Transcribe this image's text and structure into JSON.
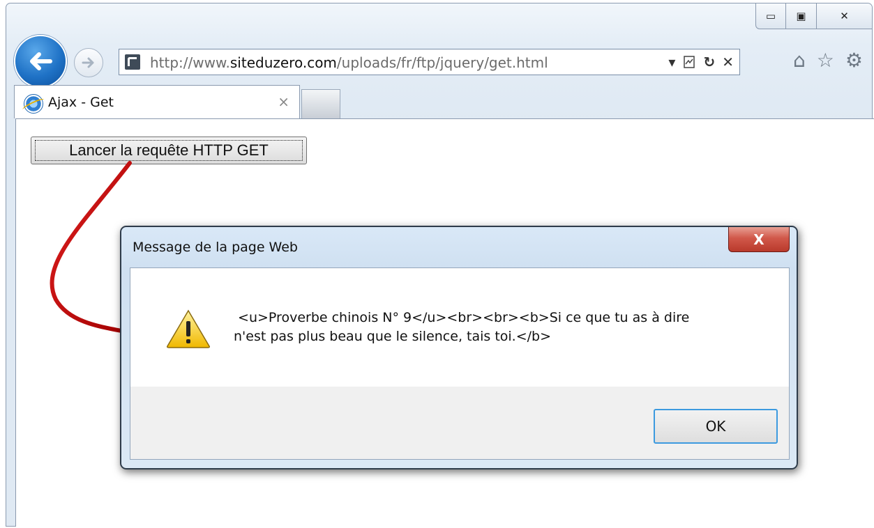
{
  "browser": {
    "url_prefix": "http://www.",
    "url_domain": "siteduzero.com",
    "url_path": "/uploads/fr/ftp/jquery/get.html",
    "tab": {
      "label": "Ajax - Get",
      "close_glyph": "×"
    },
    "icons": {
      "back": "back-arrow-icon",
      "forward": "forward-arrow-icon",
      "site": "site-favicon-icon",
      "dropdown": "▾",
      "compat": "compatibility-view-icon",
      "refresh": "↻",
      "stop": "✕",
      "home": "⌂",
      "favorites": "☆",
      "tools": "⚙"
    },
    "caption": {
      "minimize": "▭",
      "maximize": "▣",
      "close": "✕"
    }
  },
  "page": {
    "button_label": "Lancer la requête HTTP GET"
  },
  "dialog": {
    "title": "Message de la page Web",
    "close_glyph": "X",
    "message": " <u>Proverbe chinois N° 9</u><br><br><b>Si ce que tu as à dire\nn'est pas plus beau que le silence, tais toi.</b>",
    "ok_label": "OK",
    "icon": "warning-icon"
  },
  "colors": {
    "arrow": "#c00000",
    "back_button": "#1f72c6",
    "dialog_close": "#c84a3d",
    "ok_border": "#3c9adf"
  }
}
